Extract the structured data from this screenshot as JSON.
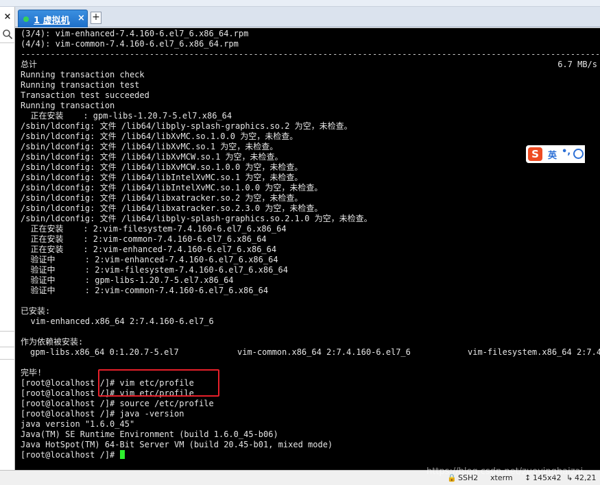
{
  "tab": {
    "label": "1 虚拟机",
    "close": "×",
    "add": "+"
  },
  "left_panel": {
    "close": "×"
  },
  "terminal": {
    "lines": [
      "(3/4): vim-enhanced-7.4.160-6.el7_6.x86_64.rpm",
      "(4/4): vim-common-7.4.160-6.el7_6.x86_64.rpm",
      "--------------------------------------------------------------------------------------------------------------------------",
      "总计",
      "Running transaction check",
      "Running transaction test",
      "Transaction test succeeded",
      "Running transaction",
      "  正在安装    : gpm-libs-1.20.7-5.el7.x86_64",
      "/sbin/ldconfig: 文件 /lib64/libply-splash-graphics.so.2 为空，未检查。",
      "/sbin/ldconfig: 文件 /lib64/libXvMC.so.1.0.0 为空，未检查。",
      "/sbin/ldconfig: 文件 /lib64/libXvMC.so.1 为空，未检查。",
      "/sbin/ldconfig: 文件 /lib64/libXvMCW.so.1 为空，未检查。",
      "/sbin/ldconfig: 文件 /lib64/libXvMCW.so.1.0.0 为空，未检查。",
      "/sbin/ldconfig: 文件 /lib64/libIntelXvMC.so.1 为空，未检查。",
      "/sbin/ldconfig: 文件 /lib64/libIntelXvMC.so.1.0.0 为空，未检查。",
      "/sbin/ldconfig: 文件 /lib64/libxatracker.so.2 为空，未检查。",
      "/sbin/ldconfig: 文件 /lib64/libxatracker.so.2.3.0 为空，未检查。",
      "/sbin/ldconfig: 文件 /lib64/libply-splash-graphics.so.2.1.0 为空，未检查。",
      "  正在安装    : 2:vim-filesystem-7.4.160-6.el7_6.x86_64",
      "  正在安装    : 2:vim-common-7.4.160-6.el7_6.x86_64",
      "  正在安装    : 2:vim-enhanced-7.4.160-6.el7_6.x86_64",
      "  验证中      : 2:vim-enhanced-7.4.160-6.el7_6.x86_64",
      "  验证中      : 2:vim-filesystem-7.4.160-6.el7_6.x86_64",
      "  验证中      : gpm-libs-1.20.7-5.el7.x86_64",
      "  验证中      : 2:vim-common-7.4.160-6.el7_6.x86_64",
      "",
      "已安装:",
      "  vim-enhanced.x86_64 2:7.4.160-6.el7_6",
      "",
      "作为依赖被安装:",
      "",
      "",
      "完毕!",
      "[root@localhost /]# vim etc/profile",
      "[root@localhost /]# vim etc/profile",
      "[root@localhost /]# source /etc/profile",
      "[root@localhost /]# java -version",
      "java version \"1.6.0_45\"",
      "Java(TM) SE Runtime Environment (build 1.6.0_45-b06)",
      "Java HotSpot(TM) 64-Bit Server VM (build 20.45-b01, mixed mode)",
      "[root@localhost /]# "
    ],
    "speed": "6.7 MB/s",
    "deps": [
      "gpm-libs.x86_64 0:1.20.7-5.el7",
      "vim-common.x86_64 2:7.4.160-6.el7_6",
      "vim-filesystem.x86_64 2:7.4."
    ]
  },
  "ime": {
    "logo": "S",
    "lang": "英",
    "punct": "•,"
  },
  "statusbar": {
    "protocol": "SSH2",
    "term": "xterm",
    "size": "145x42",
    "position": "42,21"
  },
  "watermark": "https://blog.csdn.net/zuoyinghaizai",
  "colors": {
    "tab_active": "#1e6fc8",
    "cursor": "#2ef02e",
    "highlight": "#e8202a",
    "ime_logo": "#ee4b22"
  }
}
